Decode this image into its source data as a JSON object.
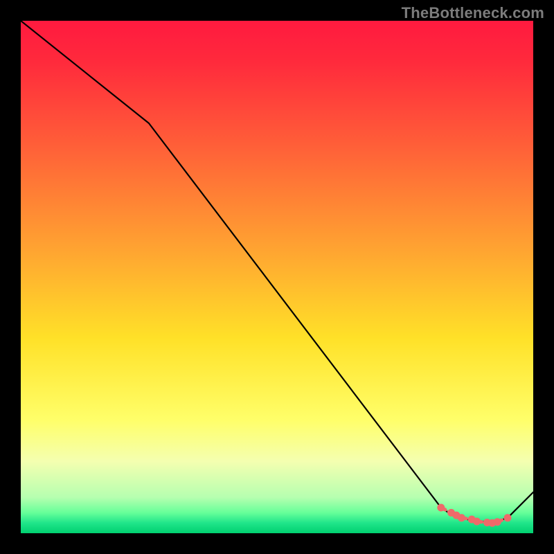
{
  "watermark": "TheBottleneck.com",
  "chart_data": {
    "type": "line",
    "title": "",
    "xlabel": "",
    "ylabel": "",
    "xlim": [
      0,
      100
    ],
    "ylim": [
      0,
      100
    ],
    "series": [
      {
        "name": "bottleneck-curve",
        "x": [
          0,
          25,
          82,
          85,
          92,
          95,
          100
        ],
        "y": [
          100,
          80,
          5,
          3,
          2,
          3,
          8
        ]
      }
    ],
    "markers": {
      "name": "highlight-band",
      "x": [
        82,
        84,
        85,
        86,
        88,
        89,
        91,
        92,
        93,
        95
      ],
      "y": [
        5,
        4,
        3.5,
        3,
        2.7,
        2.3,
        2.1,
        2.0,
        2.2,
        3.0
      ]
    },
    "background_gradient": {
      "stops": [
        {
          "pct": 0,
          "color": "#ff1a3f"
        },
        {
          "pct": 8,
          "color": "#ff2a3c"
        },
        {
          "pct": 25,
          "color": "#ff6138"
        },
        {
          "pct": 45,
          "color": "#ffa531"
        },
        {
          "pct": 62,
          "color": "#ffe128"
        },
        {
          "pct": 78,
          "color": "#ffff6a"
        },
        {
          "pct": 86,
          "color": "#f4ffb0"
        },
        {
          "pct": 93,
          "color": "#b6ffb0"
        },
        {
          "pct": 96,
          "color": "#66ff99"
        },
        {
          "pct": 98,
          "color": "#20e58a"
        },
        {
          "pct": 100,
          "color": "#00d070"
        }
      ]
    }
  }
}
